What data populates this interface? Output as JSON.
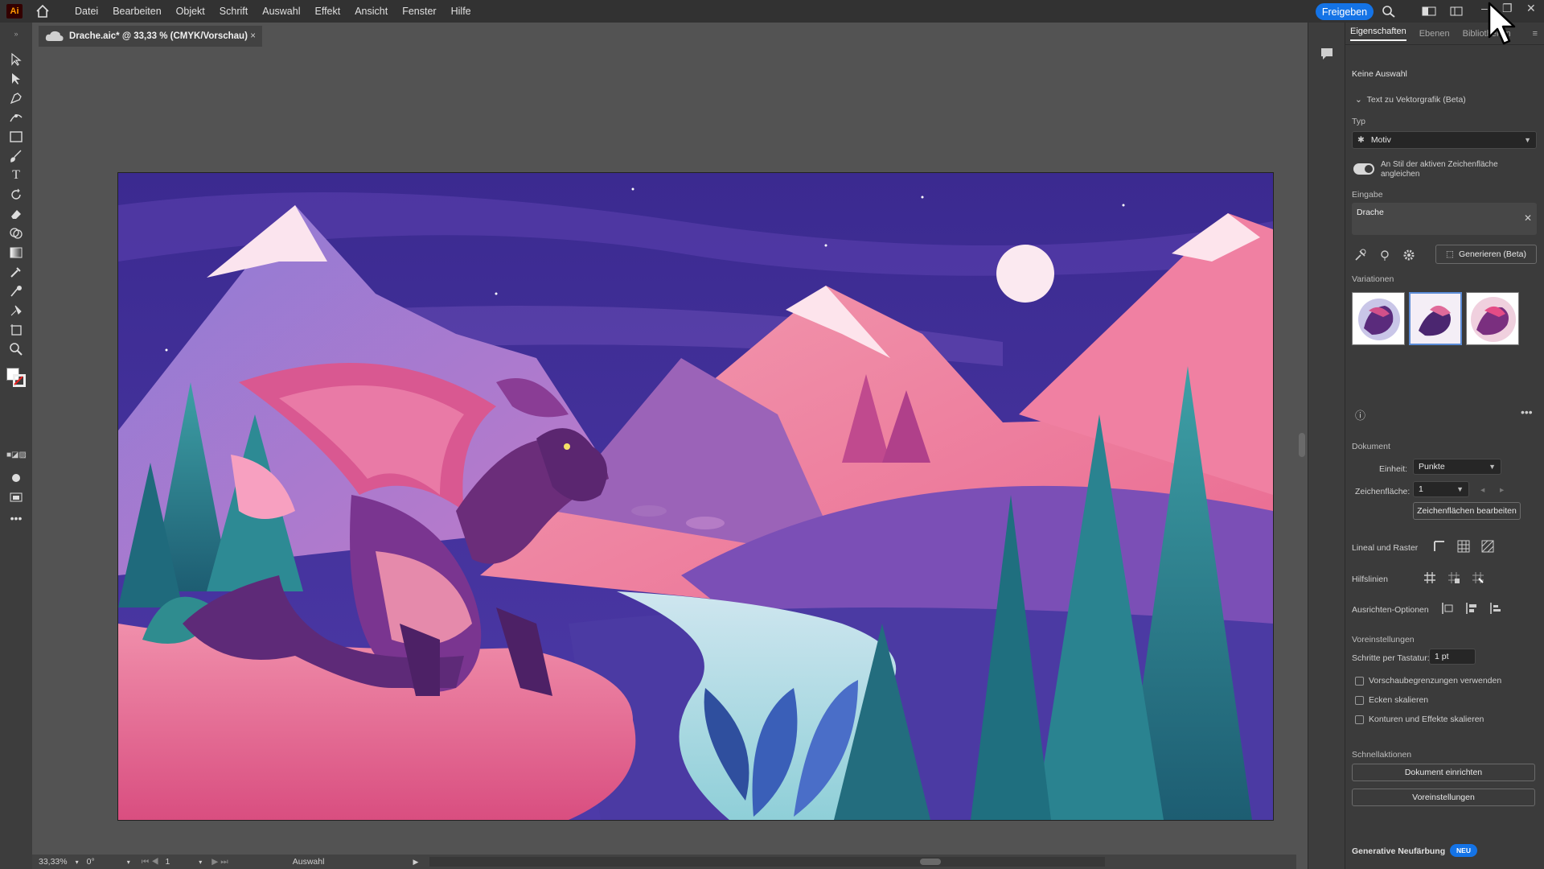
{
  "app": {
    "logo": "Ai"
  },
  "menu": [
    "Datei",
    "Bearbeiten",
    "Objekt",
    "Schrift",
    "Auswahl",
    "Effekt",
    "Ansicht",
    "Fenster",
    "Hilfe"
  ],
  "share_label": "Freigeben",
  "document_tab": {
    "title": "Drache.aic* @ 33,33 % (CMYK/Vorschau)",
    "close": "×"
  },
  "status": {
    "zoom": "33,33%",
    "rotation": "0°",
    "artboard_nr": "1",
    "tool": "Auswahl"
  },
  "panel": {
    "tabs": [
      "Eigenschaften",
      "Ebenen",
      "Bibliotheken"
    ],
    "no_selection": "Keine Auswahl",
    "text_to_vector": {
      "header": "Text zu Vektorgrafik (Beta)",
      "type_label": "Typ",
      "type_value": "Motiv",
      "toggle_label": "An Stil der aktiven Zeichenfläche angleichen",
      "input_label": "Eingabe",
      "input_value": "Drache",
      "generate_label": "Generieren (Beta)",
      "variations_label": "Variationen"
    },
    "document": {
      "header": "Dokument",
      "unit_label": "Einheit:",
      "unit_value": "Punkte",
      "artboard_label": "Zeichenfläche:",
      "artboard_value": "1",
      "edit_artboards": "Zeichenflächen bearbeiten",
      "rulers_grids": "Lineal und Raster",
      "guides": "Hilfslinien",
      "align_options": "Ausrichten-Optionen"
    },
    "preferences": {
      "header": "Voreinstellungen",
      "keyboard_increment_label": "Schritte per Tastatur:",
      "keyboard_increment_value": "1 pt",
      "check1": "Vorschaubegrenzungen verwenden",
      "check2": "Ecken skalieren",
      "check3": "Konturen und Effekte skalieren"
    },
    "quick_actions": {
      "header": "Schnellaktionen",
      "btn1": "Dokument einrichten",
      "btn2": "Voreinstellungen"
    },
    "generative_recolor": {
      "label": "Generative Neufärbung",
      "badge": "NEU"
    }
  },
  "colors": {
    "accent": "#1473e6",
    "sky": "#3a2c8c",
    "river": "#a9d8e0",
    "ground": "#e8739a",
    "dragon": "#6b2d7a"
  }
}
